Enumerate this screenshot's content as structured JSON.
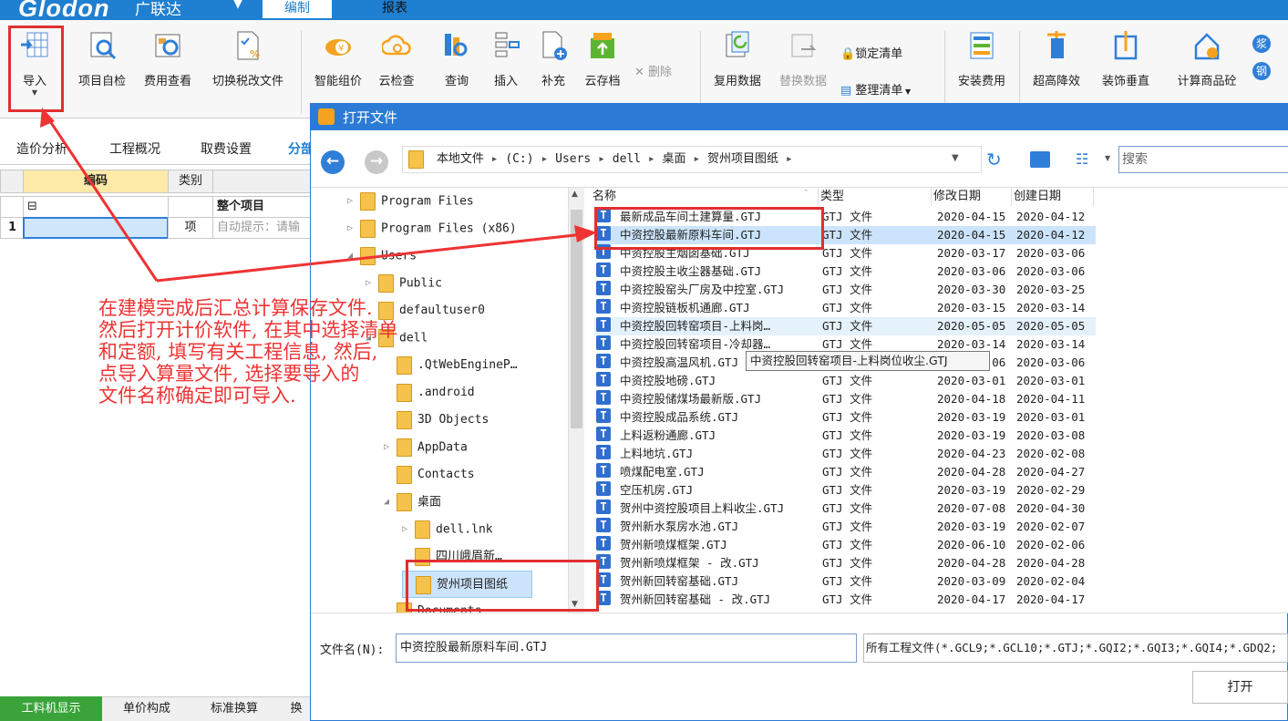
{
  "app": {
    "logo": "Glodon",
    "logo_cn": "广联达",
    "tabs": [
      "编制",
      "报表"
    ]
  },
  "ribbon": {
    "buttons": [
      "导入",
      "项目自检",
      "费用查看",
      "切换税改文件",
      "智能组价",
      "云检查",
      "查询",
      "插入",
      "补充",
      "云存档",
      "删除",
      "复用数据",
      "替换数据",
      "锁定清单",
      "整理清单",
      "安装费用",
      "超高降效",
      "装饰垂直",
      "计算商品砼"
    ],
    "side_circles": [
      "浆",
      "钢"
    ]
  },
  "left_panel": {
    "tabs": [
      "造价分析",
      "工程概况",
      "取费设置",
      "分部"
    ],
    "grid_headers": [
      "编码",
      "类别"
    ],
    "rows": [
      {
        "num": "",
        "code": "⊟",
        "type": "",
        "name": "整个项目"
      },
      {
        "num": "1",
        "code": "",
        "type": "项",
        "name": "自动提示：请输"
      }
    ],
    "bottom_tabs": [
      "工料机显示",
      "单价构成",
      "标准换算",
      "换"
    ]
  },
  "dialog": {
    "title": "打开文件",
    "breadcrumb": [
      "本地文件",
      "(C:)",
      "Users",
      "dell",
      "桌面",
      "贺州项目图纸"
    ],
    "search_placeholder": "搜索",
    "tree": [
      {
        "label": "Program Files",
        "indent": 0
      },
      {
        "label": "Program Files (x86)",
        "indent": 0
      },
      {
        "label": "Users",
        "indent": 0
      },
      {
        "label": "Public",
        "indent": 1
      },
      {
        "label": "defaultuser0",
        "indent": 1
      },
      {
        "label": "dell",
        "indent": 1
      },
      {
        "label": ".QtWebEngineP…",
        "indent": 2
      },
      {
        "label": ".android",
        "indent": 2
      },
      {
        "label": "3D Objects",
        "indent": 2
      },
      {
        "label": "AppData",
        "indent": 2
      },
      {
        "label": "Contacts",
        "indent": 2
      },
      {
        "label": "桌面",
        "indent": 2
      },
      {
        "label": "dell.lnk",
        "indent": 3
      },
      {
        "label": "四川峨眉新…",
        "indent": 3
      },
      {
        "label": "贺州项目图纸",
        "indent": 3
      },
      {
        "label": "Documents",
        "indent": 2
      }
    ],
    "columns": [
      "名称",
      "类型",
      "修改日期",
      "创建日期"
    ],
    "files": [
      {
        "name": "最新成品车间土建算量.GTJ",
        "type": "GTJ 文件",
        "modified": "2020-04-15",
        "created": "2020-04-12"
      },
      {
        "name": "中资控股最新原料车间.GTJ",
        "type": "GTJ 文件",
        "modified": "2020-04-15",
        "created": "2020-04-12"
      },
      {
        "name": "中资控股主烟囱基础.GTJ",
        "type": "GTJ 文件",
        "modified": "2020-03-17",
        "created": "2020-03-06"
      },
      {
        "name": "中资控股主收尘器基础.GTJ",
        "type": "GTJ 文件",
        "modified": "2020-03-06",
        "created": "2020-03-06"
      },
      {
        "name": "中资控股窑头厂房及中控室.GTJ",
        "type": "GTJ 文件",
        "modified": "2020-03-30",
        "created": "2020-03-25"
      },
      {
        "name": "中资控股链板机通廊.GTJ",
        "type": "GTJ 文件",
        "modified": "2020-03-15",
        "created": "2020-03-14"
      },
      {
        "name": "中资控股回转窑项目-上料岗…",
        "type": "GTJ 文件",
        "modified": "2020-05-05",
        "created": "2020-05-05"
      },
      {
        "name": "中资控股回转窑项目-冷却器…",
        "type": "GTJ 文件",
        "modified": "2020-03-14",
        "created": "2020-03-14"
      },
      {
        "name": "中资控股高温风机.GTJ",
        "type": "GTJ 文件",
        "modified": "2020-03-06",
        "created": "2020-03-06"
      },
      {
        "name": "中资控股地磅.GTJ",
        "type": "GTJ 文件",
        "modified": "2020-03-01",
        "created": "2020-03-01"
      },
      {
        "name": "中资控股储煤场最新版.GTJ",
        "type": "GTJ 文件",
        "modified": "2020-04-18",
        "created": "2020-04-11"
      },
      {
        "name": "中资控股成品系统.GTJ",
        "type": "GTJ 文件",
        "modified": "2020-03-19",
        "created": "2020-03-01"
      },
      {
        "name": "上料返粉通廊.GTJ",
        "type": "GTJ 文件",
        "modified": "2020-03-19",
        "created": "2020-03-08"
      },
      {
        "name": "上料地坑.GTJ",
        "type": "GTJ 文件",
        "modified": "2020-04-23",
        "created": "2020-02-08"
      },
      {
        "name": "喷煤配电室.GTJ",
        "type": "GTJ 文件",
        "modified": "2020-04-28",
        "created": "2020-04-27"
      },
      {
        "name": "空压机房.GTJ",
        "type": "GTJ 文件",
        "modified": "2020-03-19",
        "created": "2020-02-29"
      },
      {
        "name": "贺州中资控股项目上料收尘.GTJ",
        "type": "GTJ 文件",
        "modified": "2020-07-08",
        "created": "2020-04-30"
      },
      {
        "name": "贺州新水泵房水池.GTJ",
        "type": "GTJ 文件",
        "modified": "2020-03-19",
        "created": "2020-02-07"
      },
      {
        "name": "贺州新喷煤框架.GTJ",
        "type": "GTJ 文件",
        "modified": "2020-06-10",
        "created": "2020-02-06"
      },
      {
        "name": "贺州新喷煤框架 - 改.GTJ",
        "type": "GTJ 文件",
        "modified": "2020-04-28",
        "created": "2020-04-28"
      },
      {
        "name": "贺州新回转窑基础.GTJ",
        "type": "GTJ 文件",
        "modified": "2020-03-09",
        "created": "2020-02-04"
      },
      {
        "name": "贺州新回转窑基础 - 改.GTJ",
        "type": "GTJ 文件",
        "modified": "2020-04-17",
        "created": "2020-04-17"
      }
    ],
    "tooltip": "中资控股回转窑项目-上料岗位收尘.GTJ",
    "filename_label": "文件名(N):",
    "filename_value": "中资控股最新原料车间.GTJ",
    "filter": "所有工程文件(*.GCL9;*.GCL10;*.GTJ;*.GQI2;*.GQI3;*.GQI4;*.GDQ2;",
    "open_button": "打开"
  },
  "annotation": "在建模完成后汇总计算保存文件.\n然后打开计价软件, 在其中选择清单\n和定额, 填写有关工程信息, 然后,\n点导入算量文件, 选择要导入的\n文件名称确定即可导入.",
  "colors": {
    "accent": "#1f7fd0",
    "dialog_title": "#2b7bd6",
    "annotation_red": "#e33333"
  }
}
